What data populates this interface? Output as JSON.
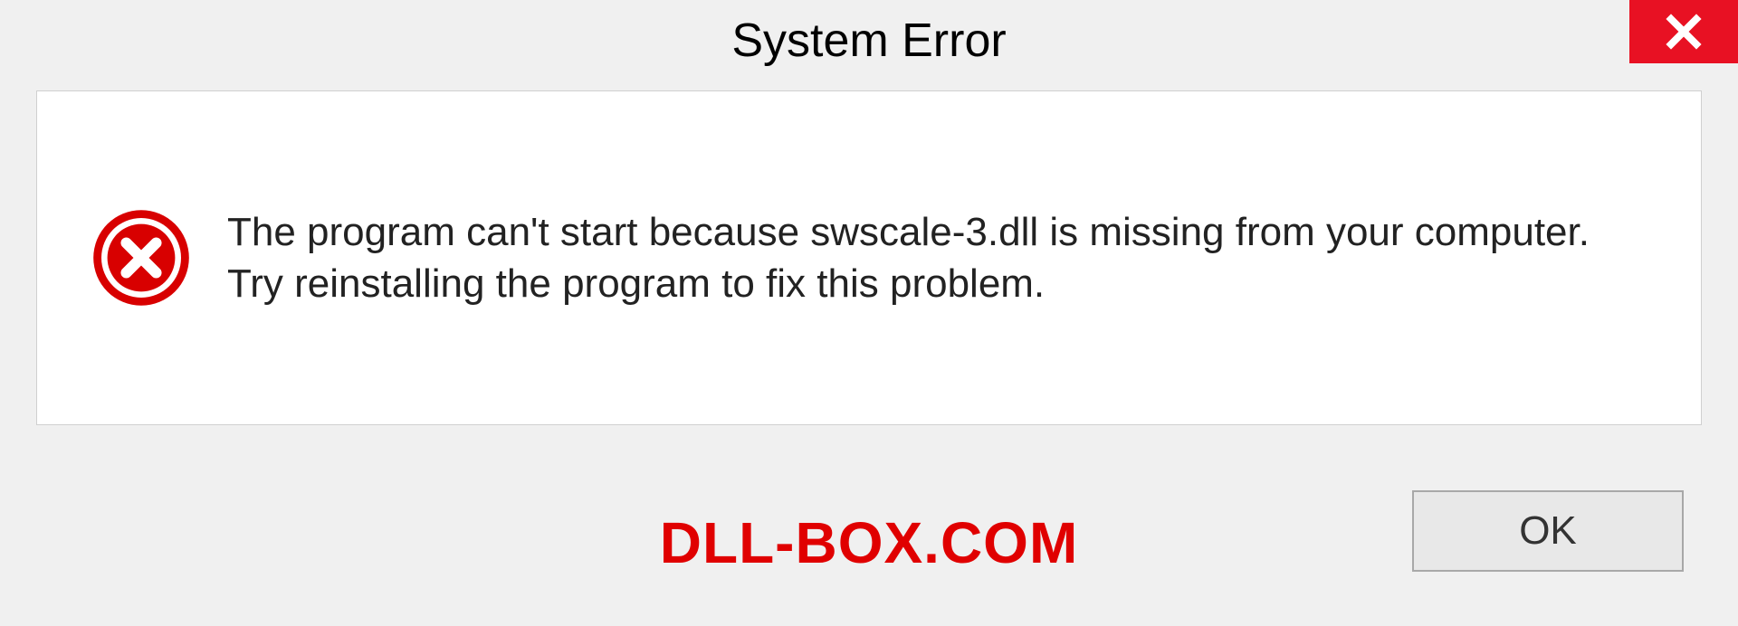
{
  "dialog": {
    "title": "System Error",
    "message": "The program can't start because swscale-3.dll is missing from your computer. Try reinstalling the program to fix this problem.",
    "ok_label": "OK"
  },
  "watermark": "DLL-BOX.COM"
}
